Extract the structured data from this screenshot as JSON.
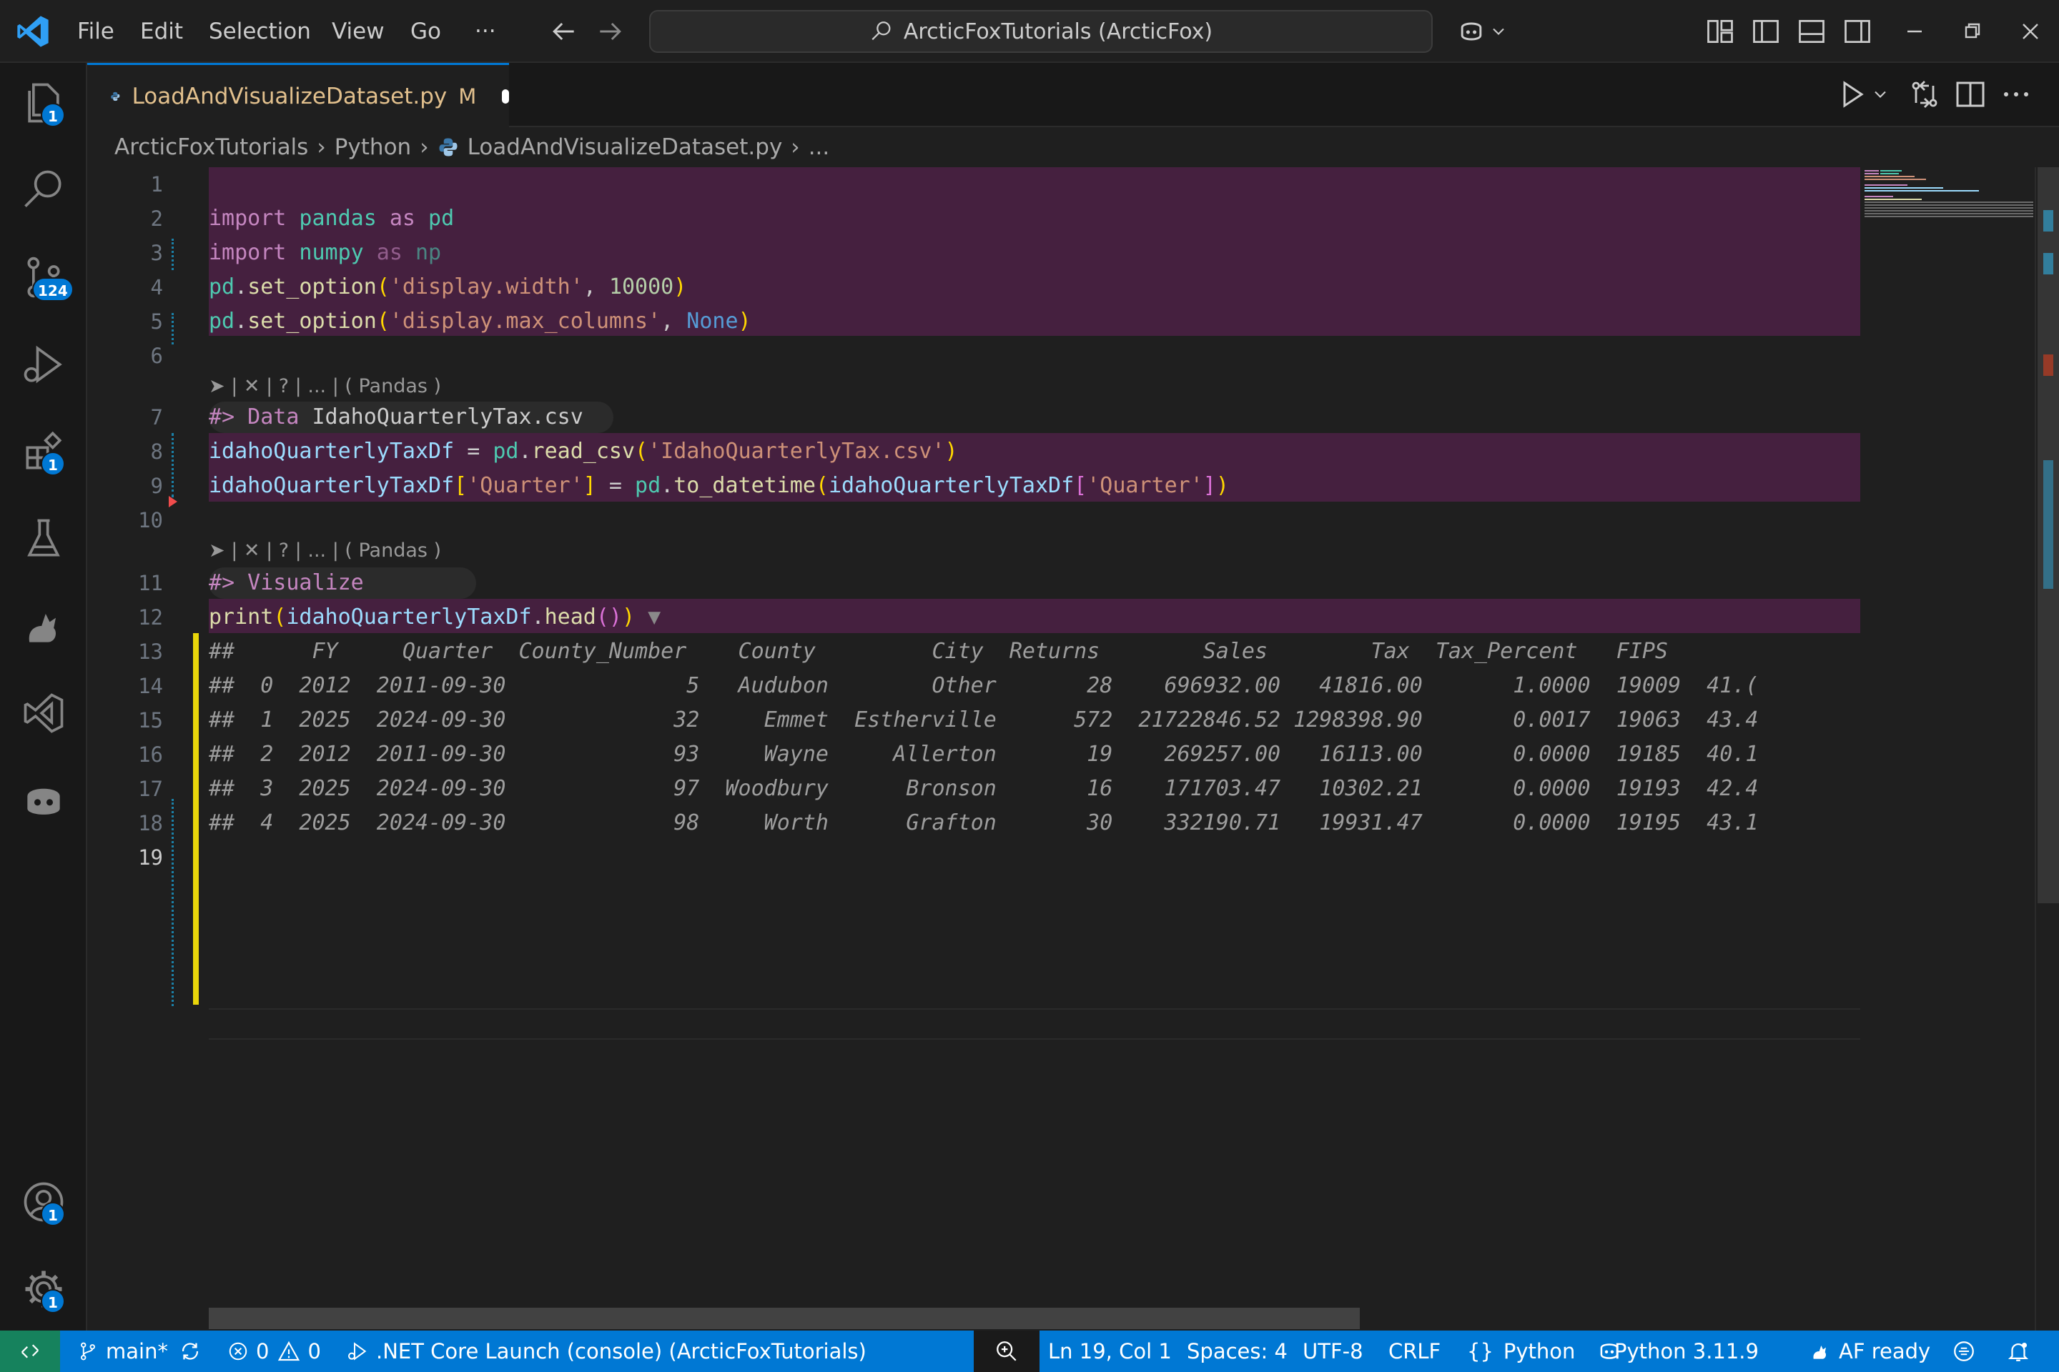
{
  "menu": {
    "file": "File",
    "edit": "Edit",
    "selection": "Selection",
    "view": "View",
    "go": "Go",
    "more": "···"
  },
  "search": {
    "label": "ArcticFoxTutorials (ArcticFox)"
  },
  "activity": {
    "explorer_badge": "1",
    "scm_badge": "124",
    "extensions_badge": "1",
    "accounts_badge": "1",
    "settings_badge": "1"
  },
  "tab": {
    "title": "LoadAndVisualizeDataset.py",
    "modified": "M"
  },
  "breadcrumb": {
    "root": "ArcticFoxTutorials",
    "folder": "Python",
    "file": "LoadAndVisualizeDataset.py",
    "more": "..."
  },
  "editor": {
    "line_numbers": [
      "1",
      "2",
      "3",
      "4",
      "5",
      "6",
      "7",
      "8",
      "9",
      "10",
      "11",
      "12",
      "13",
      "14",
      "15",
      "16",
      "17",
      "18",
      "19"
    ],
    "codelens": "➤ | ✕ | ? | ... | ( Pandas )",
    "code": {
      "l2": {
        "kw1": "import",
        "mod": " pandas",
        "kw2": " as",
        "alias": " pd"
      },
      "l3": {
        "kw1": "import",
        "mod": " numpy",
        "kw2": " as",
        "alias": " np"
      },
      "l4": {
        "obj": "pd",
        "dot": ".",
        "fn": "set_option",
        "open": "(",
        "str": "'display.width'",
        "comma": ", ",
        "num": "10000",
        "close": ")"
      },
      "l5": {
        "obj": "pd",
        "dot": ".",
        "fn": "set_option",
        "open": "(",
        "str": "'display.max_columns'",
        "comma": ", ",
        "const": "None",
        "close": ")"
      },
      "l7": {
        "marker": "#> Data",
        "name": " IdahoQuarterlyTax.csv"
      },
      "l8": {
        "var": "idahoQuarterlyTaxDf",
        "eq": " = ",
        "obj": "pd",
        "dot": ".",
        "fn": "read_csv",
        "open": "(",
        "str": "'IdahoQuarterlyTax.csv'",
        "close": ")"
      },
      "l9": {
        "var": "idahoQuarterlyTaxDf",
        "ob": "[",
        "key": "'Quarter'",
        "cb": "]",
        "eq": " = ",
        "obj": "pd",
        "dot": ".",
        "fn": "to_datetime",
        "open": "(",
        "var2": "idahoQuarterlyTaxDf",
        "ob2": "[",
        "key2": "'Quarter'",
        "cb2": "]",
        "close": ")"
      },
      "l11": {
        "marker": "#> Visualize"
      },
      "l12": {
        "fn": "print",
        "open": "(",
        "var": "idahoQuarterlyTaxDf",
        "dot": ".",
        "fn2": "head",
        "inner": "()",
        "close": ")",
        "fold": " ▼"
      }
    },
    "output": [
      "##      FY     Quarter  County_Number    County         City  Returns        Sales        Tax  Tax_Percent   FIPS",
      "##  0  2012  2011-09-30              5   Audubon        Other       28    696932.00   41816.00       1.0000  19009  41.(",
      "##  1  2025  2024-09-30             32     Emmet  Estherville      572  21722846.52 1298398.90       0.0017  19063  43.4",
      "##  2  2012  2011-09-30             93     Wayne     Allerton       19    269257.00   16113.00       0.0000  19185  40.1",
      "##  3  2025  2024-09-30             97  Woodbury      Bronson       16    171703.47   10302.21       0.0000  19193  42.4",
      "##  4  2025  2024-09-30             98     Worth      Grafton       30    332190.71   19931.47       0.0000  19195  43.1"
    ]
  },
  "status": {
    "branch": "main*",
    "errors": "0",
    "warnings": "0",
    "launch": ".NET Core Launch (console) (ArcticFoxTutorials)",
    "position": "Ln 19, Col 1",
    "spaces": "Spaces: 4",
    "encoding": "UTF-8",
    "eol": "CRLF",
    "language": "Python",
    "interpreter": "Python 3.11.9",
    "af": "AF ready"
  },
  "colors": {
    "accent": "#0078d4",
    "remote": "#16825d",
    "cell_highlight": "#45203f"
  }
}
